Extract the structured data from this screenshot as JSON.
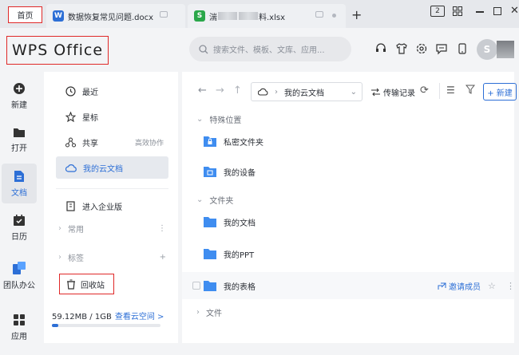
{
  "tabs": {
    "home": "首页",
    "doc_tab": "数据恢复常见问题.docx",
    "xls_tab_prefix": "湍",
    "xls_tab_suffix": "料.xlsx"
  },
  "window": {
    "count_badge": "2"
  },
  "header": {
    "logo": "WPS Office",
    "search_placeholder": "搜索文件、模板、文库、应用...",
    "avatar_letter": "S"
  },
  "rail": {
    "new": "新建",
    "open": "打开",
    "docs": "文档",
    "calendar": "日历",
    "team": "团队办公",
    "apps": "应用"
  },
  "nav": {
    "recent": "最近",
    "starred": "星标",
    "shared": "共享",
    "shared_extra": "高效协作",
    "cloud": "我的云文档",
    "enterprise": "进入企业版",
    "common": "常用",
    "tags": "标签",
    "recycle": "回收站",
    "storage": "59.12MB / 1GB",
    "storage_link": "查看云空间 >",
    "storage_fraction": 0.06
  },
  "main": {
    "path_root": "我的云文档",
    "transfer": "传输记录",
    "new_button": "+ 新建",
    "group_special": "特殊位置",
    "private_folder": "私密文件夹",
    "my_device": "我的设备",
    "group_folders": "文件夹",
    "my_docs": "我的文档",
    "my_ppt": "我的PPT",
    "my_sheets": "我的表格",
    "invite": "邀请成员",
    "group_files": "文件"
  },
  "colors": {
    "accent": "#2d6fd6",
    "folder": "#3f8df0",
    "highlight_box": "#e02828",
    "sheet_icon": "#2aa74a",
    "writer_icon": "#2d6fd6"
  }
}
